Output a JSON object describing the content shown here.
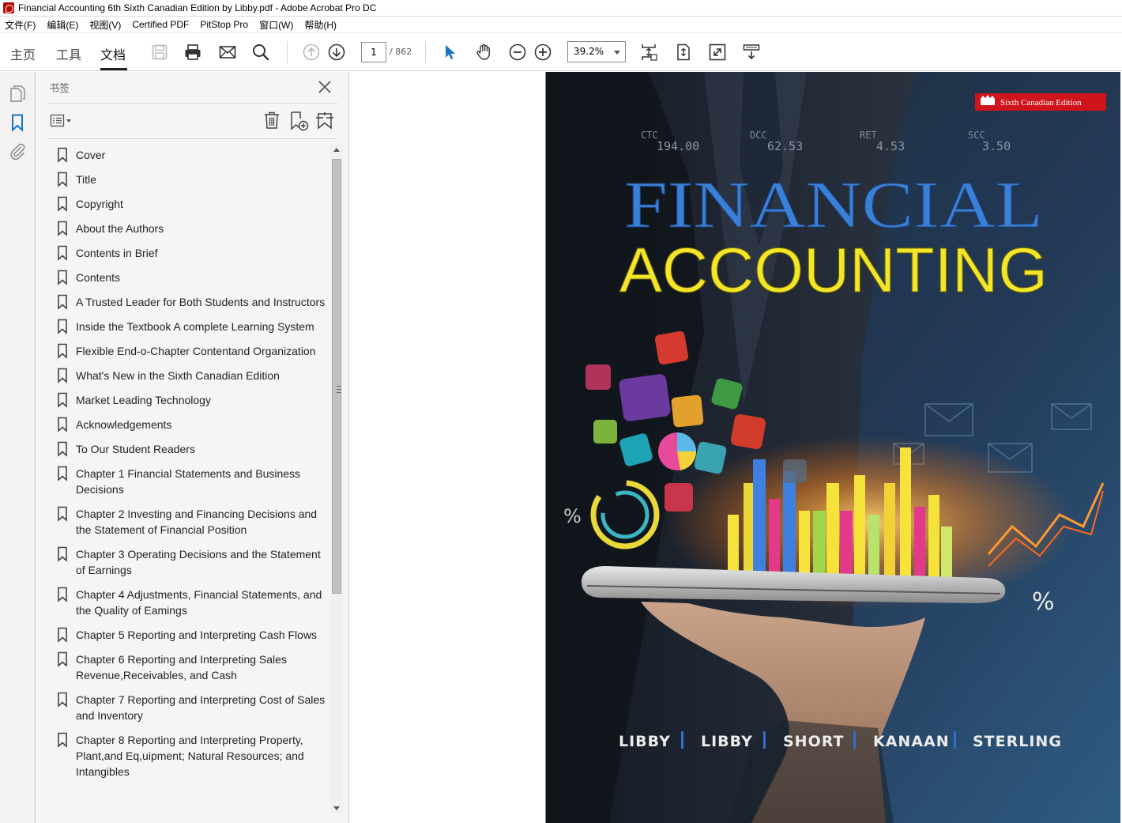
{
  "window": {
    "title": "Financial Accounting 6th Sixth Canadian Edition by Libby.pdf - Adobe Acrobat Pro DC"
  },
  "menu": {
    "items": [
      "文件(F)",
      "编辑(E)",
      "视图(V)",
      "Certified PDF",
      "PitStop Pro",
      "窗口(W)",
      "帮助(H)"
    ]
  },
  "toolbar": {
    "tabs": [
      "主页",
      "工具",
      "文档"
    ],
    "active_tab": "文档",
    "page_current": "1",
    "page_total": "/ 862",
    "zoom": "39.2%"
  },
  "bookmarks": {
    "title": "书签",
    "items": [
      "Cover",
      "Title",
      "Copyright",
      "About the Authors",
      "Contents in Brief",
      "Contents",
      "A Trusted Leader for Both Students and Instructors",
      "Inside the Textbook A complete Learning System",
      "Flexible End-o-Chapter Contentand Organization",
      "What's New in the Sixth Canadian Edition",
      "Market Leading Technology",
      "Acknowledgements",
      "To Our Student Readers",
      "Chapter 1 Financial Statements and Business Decisions",
      "Chapter 2 Investing and Financing Decisions and the Statement of Financial Position",
      "Chapter 3 Operating Decisions and the Statement of Earnings",
      "Chapter 4 Adjustments, Financial Statements, and the Quality of Eamings",
      "Chapter 5 Reporting and Interpreting Cash Flows",
      "Chapter 6 Reporting and Interpreting Sales Revenue,Receivables, and Cash",
      "Chapter 7 Reporting and Interpreting Cost of Sales and Inventory",
      "Chapter 8 Reporting and Interpreting Property, Plant,and Eq,uipment; Natural Resources; and Intangibles"
    ]
  },
  "cover": {
    "edition_badge": "Sixth Canadian Edition",
    "title_line1": "FINANCIAL",
    "title_line2": "ACCOUNTING",
    "authors": [
      "LIBBY",
      "LIBBY",
      "SHORT",
      "KANAAN",
      "STERLING"
    ],
    "ticker_labels": [
      "CTC",
      "DCC",
      "RET",
      "SCC"
    ],
    "ticker_values": [
      "194.00",
      "62.53",
      "4.53",
      "3.50"
    ],
    "percent_sign": "%"
  },
  "colors": {
    "accent": "#1a73c8",
    "cover_title_blue": "#3a7fd8",
    "cover_title_yellow": "#f2e52a",
    "badge_red": "#d0141b"
  }
}
